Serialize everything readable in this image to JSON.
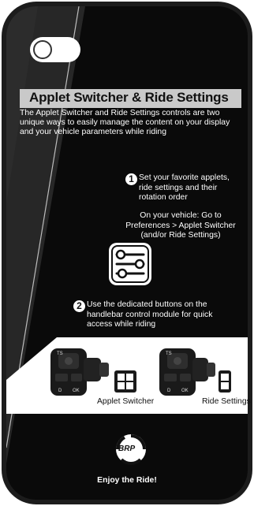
{
  "title": "Applet Switcher & Ride Settings",
  "intro": "The Applet Switcher and Ride Settings controls are two unique ways to easily manage the content on your display and your vehicle parameters while riding",
  "step1": {
    "number": "1",
    "text": "Set your favorite applets, ride settings and their rotation order",
    "vehicle_text": "On your vehicle: Go to Preferences > Applet Switcher (and/or Ride Settings)"
  },
  "step2": {
    "number": "2",
    "text": "Use the dedicated buttons on the handlebar control module for quick access while riding"
  },
  "applet_label": "Applet Switcher",
  "ride_label": "Ride Settings",
  "brand_logo_text": "BRP",
  "footer": "Enjoy the Ride!",
  "icons": {
    "settings": "sliders-icon",
    "applet": "grid-four-icon",
    "ride": "stack-two-icon",
    "logo": "brp-logo"
  },
  "colors": {
    "phone_frame": "#1c1c1c",
    "screen_dark": "#0a0a0a",
    "title_band": "#c9c9c9",
    "text_light": "#ffffff",
    "text_dark": "#111111"
  }
}
